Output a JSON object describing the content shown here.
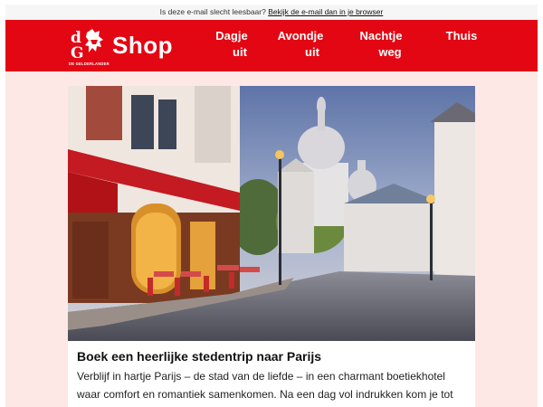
{
  "preheader": {
    "text": "Is deze e-mail slecht leesbaar?",
    "link": "Bekijk de e-mail dan in je browser"
  },
  "brand": {
    "logo_mark": "dG",
    "logo_subtitle": "DE GELDERLANDER",
    "shop_label": "Shop",
    "colors": {
      "primary": "#e30613",
      "background": "#fde8e6"
    }
  },
  "nav": {
    "items": [
      {
        "line1": "Dagje",
        "line2": "uit"
      },
      {
        "line1": "Avondje",
        "line2": "uit"
      },
      {
        "line1": "Nachtje",
        "line2": "weg"
      },
      {
        "line1": "Thuis",
        "line2": ""
      }
    ]
  },
  "article": {
    "hero_icon": "paris-montmartre-photo",
    "title": "Boek een heerlijke stedentrip naar Parijs",
    "body": "Verblijf in hartje Parijs – de stad van de liefde – in een charmant boetiekhotel waar comfort en romantiek samenkomen. Na een dag vol indrukken kom je tot rust in de sfeervolle ruimtes en geniet je van de charme van deze stad."
  }
}
